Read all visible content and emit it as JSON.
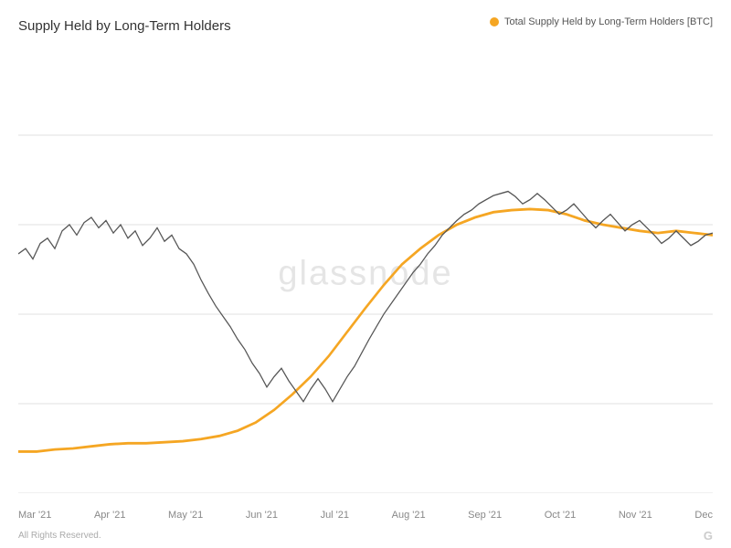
{
  "title": "Supply Held by Long-Term Holders",
  "legend": {
    "dot_color": "#f5a623",
    "label": "Total Supply Held by Long-Term Holders [BTC]"
  },
  "watermark": "glassnode",
  "x_axis_labels": [
    "Mar '21",
    "Apr '21",
    "May '21",
    "Jun '21",
    "Jul '21",
    "Aug '21",
    "Sep '21",
    "Oct '21",
    "Nov '21",
    "Dec"
  ],
  "footer": {
    "copyright": "All Rights Reserved.",
    "logo": "G"
  },
  "chart": {
    "orange_line_color": "#f5a623",
    "gray_line_color": "#555555"
  }
}
